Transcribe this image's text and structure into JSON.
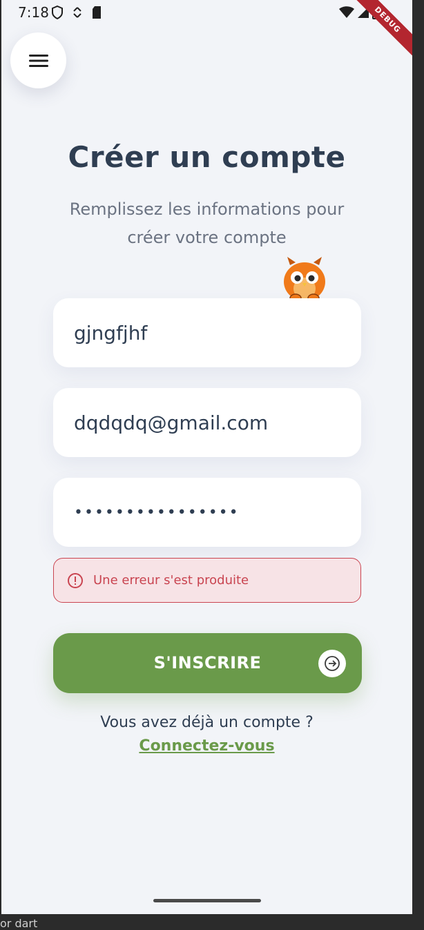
{
  "status_bar": {
    "time": "7:18",
    "left_icons": [
      "shield-icon",
      "data-saver-icon",
      "sd-card-icon"
    ],
    "right_icons": [
      "wifi-icon",
      "signal-icon",
      "battery-icon"
    ],
    "debug_label": "DEBUG"
  },
  "menu": {
    "icon": "hamburger-menu-icon"
  },
  "header": {
    "title": "Créer un compte",
    "subtitle_line1": "Remplissez les informations pour",
    "subtitle_line2": "créer votre compte"
  },
  "mascot": {
    "icon": "owl-mascot-icon"
  },
  "form": {
    "username_value": "gjngfjhf",
    "email_value": "dqdqdq@gmail.com",
    "password_value": "••••••••••••••••"
  },
  "error": {
    "icon": "error-circle-icon",
    "message": "Une erreur s'est produite"
  },
  "submit": {
    "label": "S'INSCRIRE",
    "icon": "arrow-right-icon"
  },
  "footer": {
    "prompt": "Vous avez déjà un compte ?",
    "link": "Connectez-vous"
  },
  "host": {
    "text": "or dart"
  },
  "colors": {
    "background": "#f2f4f8",
    "primary": "#6a9a4a",
    "error": "#c94450",
    "text_dark": "#2f3e52"
  }
}
